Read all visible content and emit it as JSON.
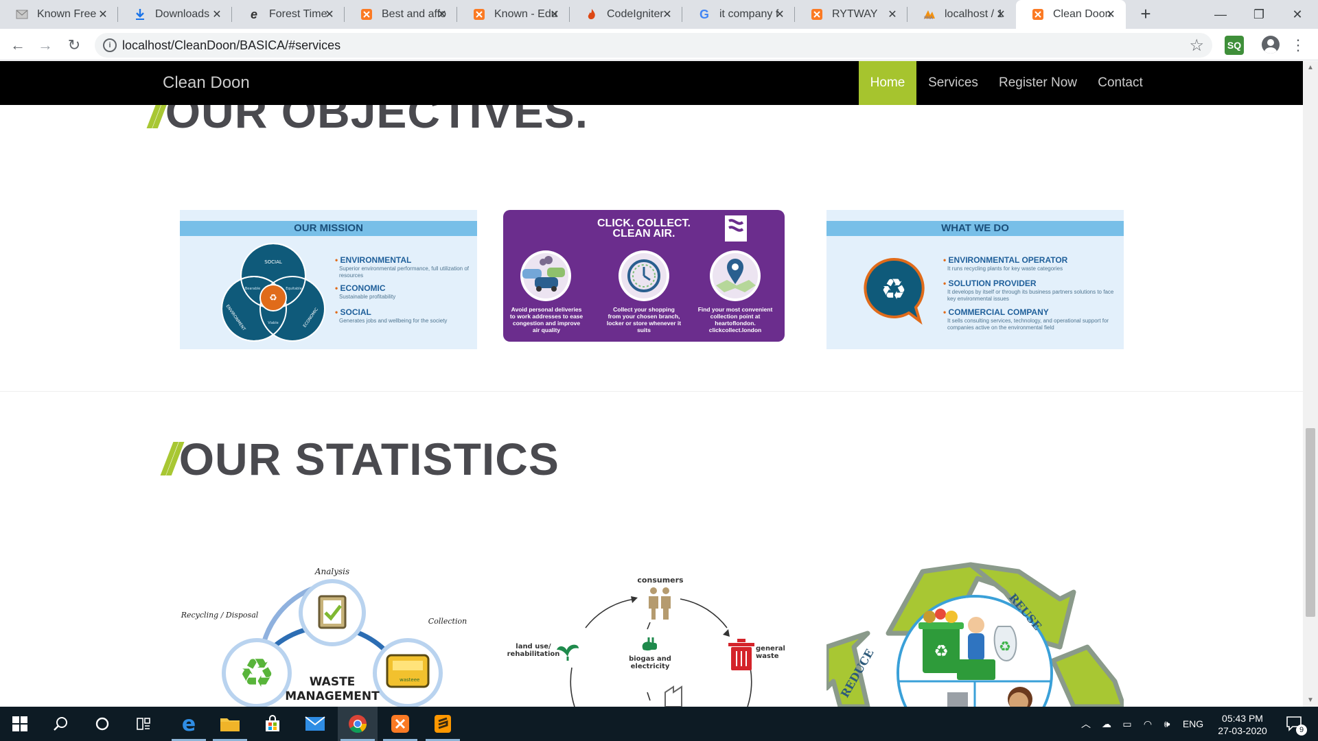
{
  "browser": {
    "tabs": [
      {
        "label": "Known Free",
        "favicon": "mail-icon",
        "active": false
      },
      {
        "label": "Downloads",
        "favicon": "download-icon",
        "active": false
      },
      {
        "label": "Forest Time",
        "favicon": "edge-icon",
        "active": false
      },
      {
        "label": "Best and affo",
        "favicon": "xampp-icon",
        "active": false
      },
      {
        "label": "Known - Edu",
        "favicon": "xampp-icon",
        "active": false
      },
      {
        "label": "CodeIgniter",
        "favicon": "flame-icon",
        "active": false
      },
      {
        "label": "it company f",
        "favicon": "google-icon",
        "active": false
      },
      {
        "label": "RYTWAY",
        "favicon": "xampp-icon",
        "active": false
      },
      {
        "label": "localhost / 1",
        "favicon": "phpmyadmin-icon",
        "active": false
      },
      {
        "label": "Clean Doon",
        "favicon": "xampp-icon",
        "active": true
      }
    ],
    "url": "localhost/CleanDoon/BASICA/#services",
    "extension_label": "SQ"
  },
  "site": {
    "brand": "Clean Doon",
    "nav": [
      {
        "label": "Home",
        "active": true
      },
      {
        "label": "Services",
        "active": false
      },
      {
        "label": "Register Now",
        "active": false
      },
      {
        "label": "Contact",
        "active": false
      }
    ]
  },
  "objectives": {
    "title": "OUR OBJECTIVES.",
    "mission_card": {
      "header": "OUR MISSION",
      "venn": {
        "top": "SOCIAL",
        "left": "ENVIRONMENT",
        "right": "ECONOMIC",
        "overlap_left": "Bearable",
        "overlap_right": "Equitable",
        "overlap_bottom": "Viable"
      },
      "items": [
        {
          "heading": "ENVIRONMENTAL",
          "desc": "Superior environmental performance, full utilization of resources"
        },
        {
          "heading": "ECONOMIC",
          "desc": "Sustainable profitability"
        },
        {
          "heading": "SOCIAL",
          "desc": "Generates jobs and wellbeing for the society"
        }
      ]
    },
    "click_card": {
      "title_line1": "CLICK. COLLECT.",
      "title_line2": "CLEAN AIR.",
      "captions": [
        "Avoid personal deliveries to work addresses to ease congestion and improve air quality",
        "Collect your shopping from your chosen branch, locker or store whenever it suits",
        "Find your most convenient collection point at heartoflondon. clickcollect.london"
      ]
    },
    "whatwedo_card": {
      "header": "WHAT WE DO",
      "items": [
        {
          "heading": "ENVIRONMENTAL OPERATOR",
          "desc": "It runs recycling plants for key waste categories"
        },
        {
          "heading": "SOLUTION PROVIDER",
          "desc": "It develops by itself or through its business partners solutions to face key environmental issues"
        },
        {
          "heading": "COMMERCIAL COMPANY",
          "desc": "It sells consulting services, technology, and operational support for companies active on the environmental field"
        }
      ]
    }
  },
  "statistics": {
    "title": "OUR STATISTICS",
    "waste_card": {
      "labels": {
        "analysis": "Analysis",
        "recycling": "Recycling / Disposal",
        "collection": "Collection",
        "center_line1": "WASTE",
        "center_line2": "MANAGEMENT",
        "truck_text": "wasteee"
      }
    },
    "cycle_card": {
      "labels": {
        "consumers": "consumers",
        "land_use": "land use/ rehabilitation",
        "general_waste": "general waste",
        "biogas": "biogas and electricity"
      }
    },
    "reuse_card": {
      "labels": {
        "reuse": "REUSE",
        "reduce": "REDUCE"
      }
    }
  },
  "taskbar": {
    "language": "ENG",
    "time": "05:43 PM",
    "date": "27-03-2020",
    "notification_count": "9"
  },
  "colors": {
    "accent_green": "#a6c42e",
    "navbar_bg": "#000000",
    "title_gray": "#4a4a4f",
    "mission_blue": "#78bfe8",
    "purple": "#6b2d8d",
    "teal_dark": "#0f5a7a",
    "orange": "#e06b1a"
  }
}
